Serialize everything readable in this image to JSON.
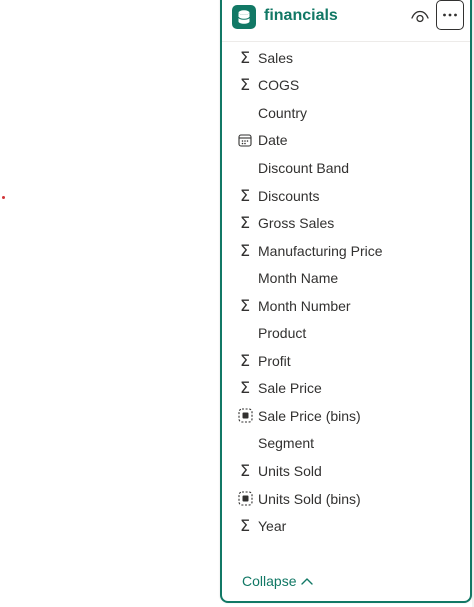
{
  "panel": {
    "title": "financials",
    "collapse_label": "Collapse",
    "accent_color": "#117865",
    "header_icons": [
      "database-icon",
      "eye-icon",
      "more-icon"
    ]
  },
  "fields": [
    {
      "label": "Sales",
      "icon": "sigma-icon"
    },
    {
      "label": "COGS",
      "icon": "sigma-icon"
    },
    {
      "label": "Country",
      "icon": "none"
    },
    {
      "label": "Date",
      "icon": "calendar-icon"
    },
    {
      "label": "Discount Band",
      "icon": "none"
    },
    {
      "label": "Discounts",
      "icon": "sigma-icon"
    },
    {
      "label": "Gross Sales",
      "icon": "sigma-icon"
    },
    {
      "label": "Manufacturing Price",
      "icon": "sigma-icon"
    },
    {
      "label": "Month Name",
      "icon": "none"
    },
    {
      "label": "Month Number",
      "icon": "sigma-icon"
    },
    {
      "label": "Product",
      "icon": "none"
    },
    {
      "label": "Profit",
      "icon": "sigma-icon"
    },
    {
      "label": "Sale Price",
      "icon": "sigma-icon"
    },
    {
      "label": "Sale Price (bins)",
      "icon": "bins-icon"
    },
    {
      "label": "Segment",
      "icon": "none"
    },
    {
      "label": "Units Sold",
      "icon": "sigma-icon"
    },
    {
      "label": "Units Sold (bins)",
      "icon": "bins-icon"
    },
    {
      "label": "Year",
      "icon": "sigma-icon"
    }
  ]
}
